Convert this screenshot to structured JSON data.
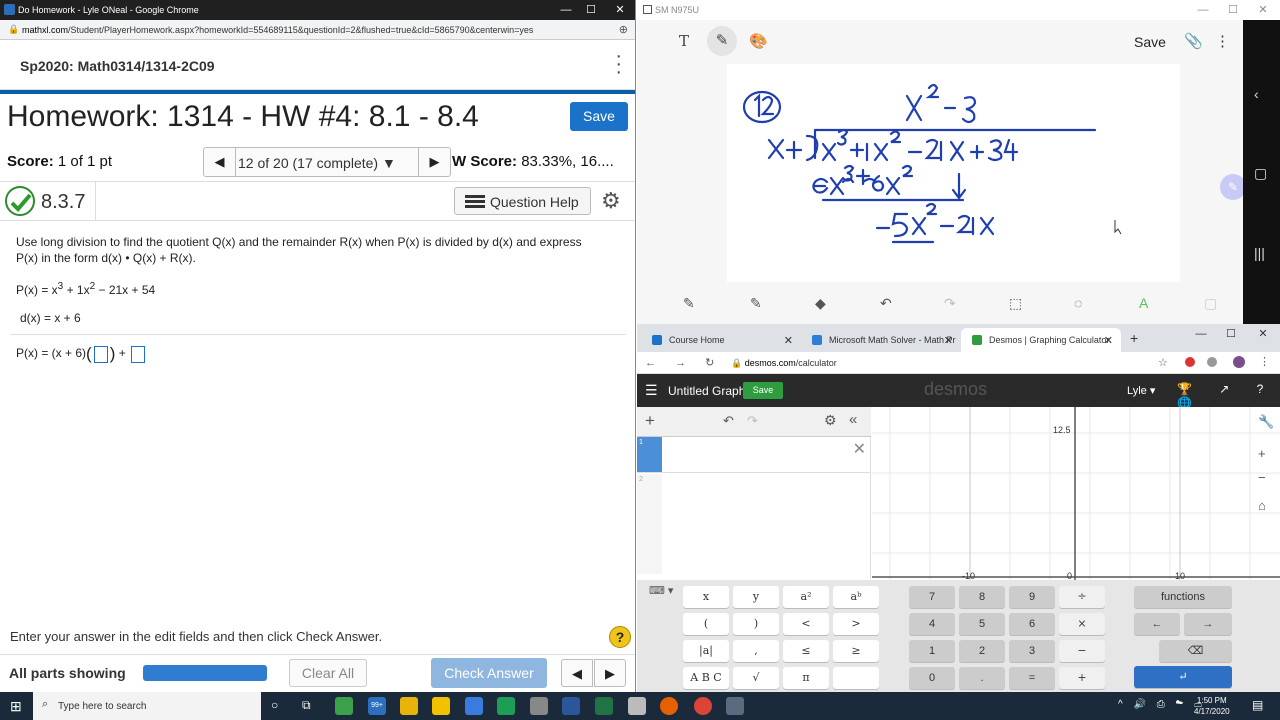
{
  "left_window": {
    "title": "Do Homework - Lyle ONeal - Google Chrome",
    "url_host": "mathxl.com",
    "url_path": "/Student/PlayerHomework.aspx?homeworkId=554689115&questionId=2&flushed=true&cId=5865790&centerwin=yes",
    "course": "Sp2020: Math0314/1314-2C09",
    "homework_title": "Homework: 1314 - HW #4: 8.1 - 8.4",
    "save_label": "Save",
    "score_label": "Score:",
    "score_value": "1 of 1 pt",
    "question_nav": "12 of 20 (17 complete)",
    "hw_score_label": "W Score:",
    "hw_score_value": "83.33%, 16....",
    "question_number": "8.3.7",
    "question_help": "Question Help",
    "instruction": "Use long division to find the quotient Q(x) and the remainder R(x) when P(x) is divided by d(x) and express P(x) in the form d(x) • Q(x) + R(x).",
    "p_label": "P(x) = x",
    "p_rest1": " + 1x",
    "p_rest2": " − 21x + 54",
    "exp3": "3",
    "exp2": "2",
    "d_expr": "d(x) = x + 6",
    "answer_prefix": "P(x) = (x + 6)",
    "answer_plus": "+",
    "footer_text": "Enter your answer in the edit fields and then click Check Answer.",
    "help_icon": "?",
    "all_parts": "All parts showing",
    "clear_all": "Clear All",
    "check_answer": "Check Answer"
  },
  "note_window": {
    "title": "SM N975U",
    "save_label": "Save"
  },
  "desmos_window": {
    "tabs": [
      {
        "label": "Course Home",
        "color": "#1a73c8"
      },
      {
        "label": "Microsoft Math Solver - Math Pr",
        "color": "#2e7dd6"
      },
      {
        "label": "Desmos | Graphing Calculator",
        "color": "#2f9c3f"
      }
    ],
    "url_host": "desmos.com",
    "url_path": "/calculator",
    "graph_name": "Untitled Graph",
    "save_label": "Save",
    "logo": "desmos",
    "user": "Lyle",
    "expr_index": "1",
    "expr_index2": "2",
    "axis": {
      "y_top_label": "12.5",
      "x_labels": [
        "-10",
        "0",
        "10"
      ]
    },
    "keys_left": [
      [
        "x",
        "y",
        "a²",
        "aᵇ"
      ],
      [
        "(",
        ")",
        "<",
        ">"
      ],
      [
        "|a|",
        ",",
        "≤",
        "≥"
      ],
      [
        "A B C",
        "√",
        "π",
        ""
      ]
    ],
    "keys_num": [
      [
        "7",
        "8",
        "9",
        "÷"
      ],
      [
        "4",
        "5",
        "6",
        "×"
      ],
      [
        "1",
        "2",
        "3",
        "−"
      ],
      [
        "0",
        ".",
        "=",
        "+"
      ]
    ],
    "functions_label": "functions"
  },
  "taskbar": {
    "search_placeholder": "Type here to search",
    "time": "1:50 PM",
    "date": "4/17/2020",
    "badge": "99+"
  }
}
